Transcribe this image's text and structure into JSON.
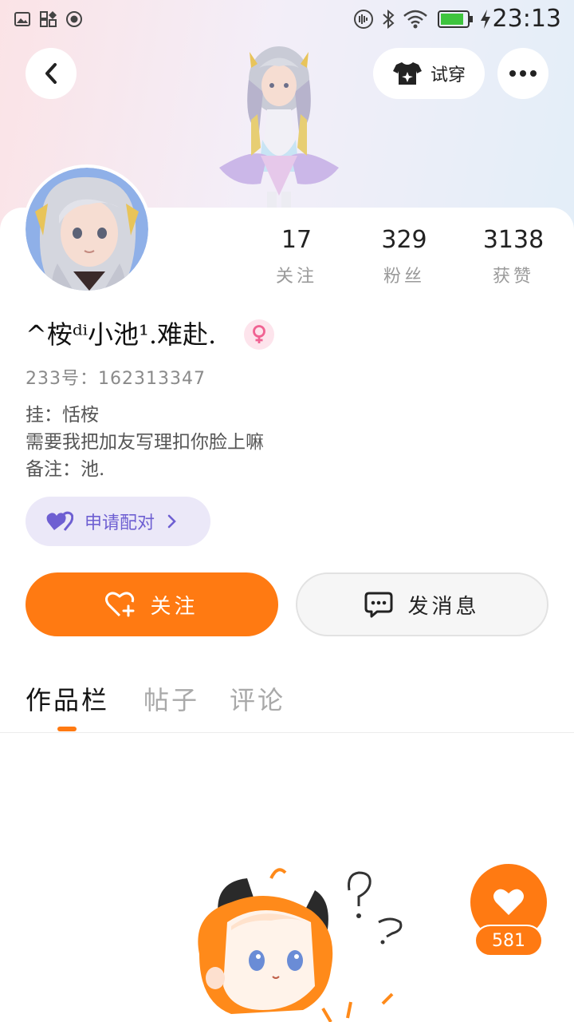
{
  "status_bar": {
    "time": "23:13",
    "battery_color": "#3ec43e"
  },
  "header": {
    "try_on_label": "试穿"
  },
  "profile": {
    "username": "^桉ᵈⁱ小池¹.难赴.",
    "gender": "female",
    "id_line": "233号：162313347",
    "bio_lines": [
      "挂：恬桉",
      "需要我把加友写理扣你脸上嘛",
      "备注：池."
    ],
    "pair_label": "申请配对"
  },
  "stats": [
    {
      "value": "17",
      "label": "关注"
    },
    {
      "value": "329",
      "label": "粉丝"
    },
    {
      "value": "3138",
      "label": "获赞"
    }
  ],
  "actions": {
    "follow_label": "关注",
    "message_label": "发消息"
  },
  "tabs": [
    {
      "label": "作品栏",
      "active": true
    },
    {
      "label": "帖子",
      "active": false
    },
    {
      "label": "评论",
      "active": false
    }
  ],
  "like_fab": {
    "count": "581"
  },
  "colors": {
    "accent": "#ff7a12",
    "pair_bg": "#ebe8f8",
    "pair_text": "#6e5fd2",
    "gender_badge": "#f06292"
  },
  "icons": {
    "back": "chevron-left-icon",
    "try_on": "shirt-icon",
    "more": "more-dots-icon",
    "follow": "heart-plus-icon",
    "message": "chat-bubble-icon",
    "pair": "double-heart-icon",
    "like": "heart-icon"
  }
}
